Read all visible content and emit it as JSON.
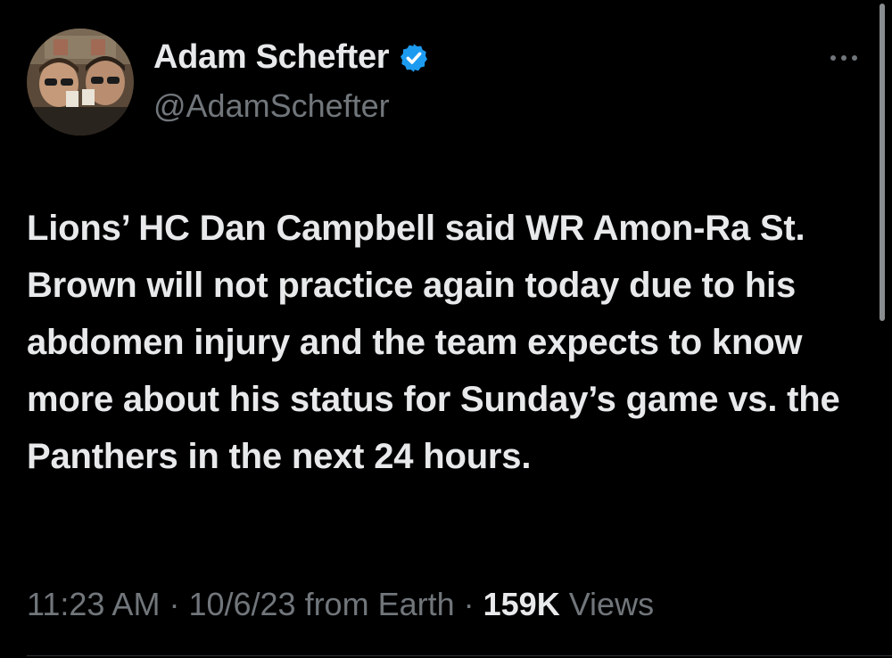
{
  "author": {
    "display_name": "Adam Schefter",
    "handle": "@AdamSchefter",
    "verified": true,
    "avatar_caption": "Ripped Off"
  },
  "tweet": {
    "text": "Lions’ HC Dan Campbell said WR Amon-Ra St. Brown will not practice again today due to his abdomen injury and the team expects to know more about his status for Sunday’s game vs. the Panthers in the next 24 hours."
  },
  "meta": {
    "time": "11:23 AM",
    "separator": " · ",
    "date": "10/6/23",
    "source": " from Earth",
    "views_count": "159K",
    "views_label": " Views"
  },
  "icons": {
    "verified": "verified-badge-icon",
    "more": "more-options-icon"
  },
  "colors": {
    "background": "#000000",
    "text_primary": "#e7e9ea",
    "text_secondary": "#71767b",
    "verified_blue": "#1d9bf0"
  }
}
